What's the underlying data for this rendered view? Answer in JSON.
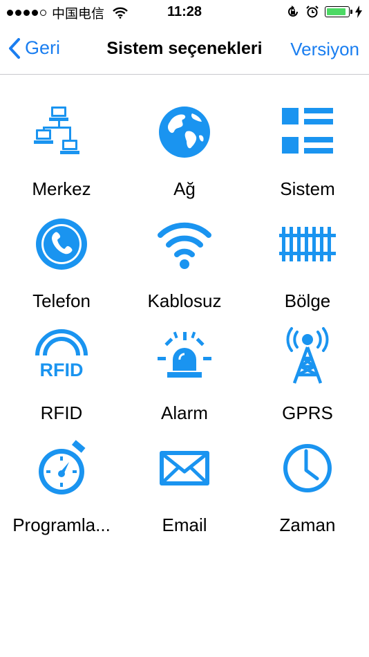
{
  "status_bar": {
    "carrier": "中国电信",
    "time": "11:28",
    "battery_level": 0.9,
    "battery_color": "#4cd964"
  },
  "nav": {
    "back_label": "Geri",
    "title": "Sistem seçenekleri",
    "right_label": "Versiyon",
    "accent_color": "#1a7ef0"
  },
  "icon_color": "#1a94f0",
  "grid_items": [
    {
      "label": "Merkez",
      "icon": "network-computers-icon"
    },
    {
      "label": "Ağ",
      "icon": "globe-icon"
    },
    {
      "label": "Sistem",
      "icon": "list-grid-icon"
    },
    {
      "label": "Telefon",
      "icon": "phone-icon"
    },
    {
      "label": "Kablosuz",
      "icon": "wifi-icon"
    },
    {
      "label": "Bölge",
      "icon": "railway-track-icon"
    },
    {
      "label": "RFID",
      "icon": "rfid-icon",
      "icon_text": "RFID"
    },
    {
      "label": "Alarm",
      "icon": "siren-icon"
    },
    {
      "label": "GPRS",
      "icon": "antenna-tower-icon"
    },
    {
      "label": "Programla...",
      "icon": "stopwatch-icon"
    },
    {
      "label": "Email",
      "icon": "envelope-icon"
    },
    {
      "label": "Zaman",
      "icon": "clock-icon"
    }
  ]
}
